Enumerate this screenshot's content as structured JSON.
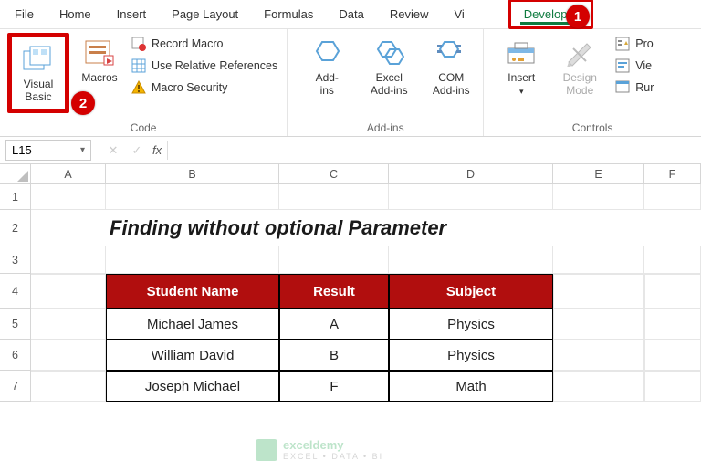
{
  "menu": {
    "tabs": [
      "File",
      "Home",
      "Insert",
      "Page Layout",
      "Formulas",
      "Data",
      "Review",
      "Vi",
      "Developer"
    ],
    "active_index": 8
  },
  "ribbon": {
    "code": {
      "label": "Code",
      "visual_basic": "Visual\nBasic",
      "macros": "Macros",
      "record_macro": "Record Macro",
      "use_relative": "Use Relative References",
      "macro_security": "Macro Security"
    },
    "addins": {
      "label": "Add-ins",
      "addins": "Add-\nins",
      "excel_addins": "Excel\nAdd-ins",
      "com_addins": "COM\nAdd-ins"
    },
    "controls": {
      "label": "Controls",
      "insert": "Insert",
      "design_mode": "Design\nMode",
      "properties": "Pro",
      "view_code": "Vie",
      "run_dialog": "Rur"
    }
  },
  "markers": {
    "one": "1",
    "two": "2"
  },
  "formula_bar": {
    "name_box": "L15",
    "fx": "fx",
    "value": ""
  },
  "columns": [
    "A",
    "B",
    "C",
    "D",
    "E",
    "F"
  ],
  "rows": [
    "1",
    "2",
    "3",
    "4",
    "5",
    "6",
    "7"
  ],
  "sheet": {
    "title": "Finding without optional Parameter",
    "headers": {
      "name": "Student Name",
      "result": "Result",
      "subject": "Subject"
    },
    "data": [
      {
        "name": "Michael James",
        "result": "A",
        "subject": "Physics"
      },
      {
        "name": "William David",
        "result": "B",
        "subject": "Physics"
      },
      {
        "name": "Joseph Michael",
        "result": "F",
        "subject": "Math"
      }
    ]
  },
  "watermark": {
    "brand": "exceldemy",
    "tag": "EXCEL • DATA • BI"
  }
}
